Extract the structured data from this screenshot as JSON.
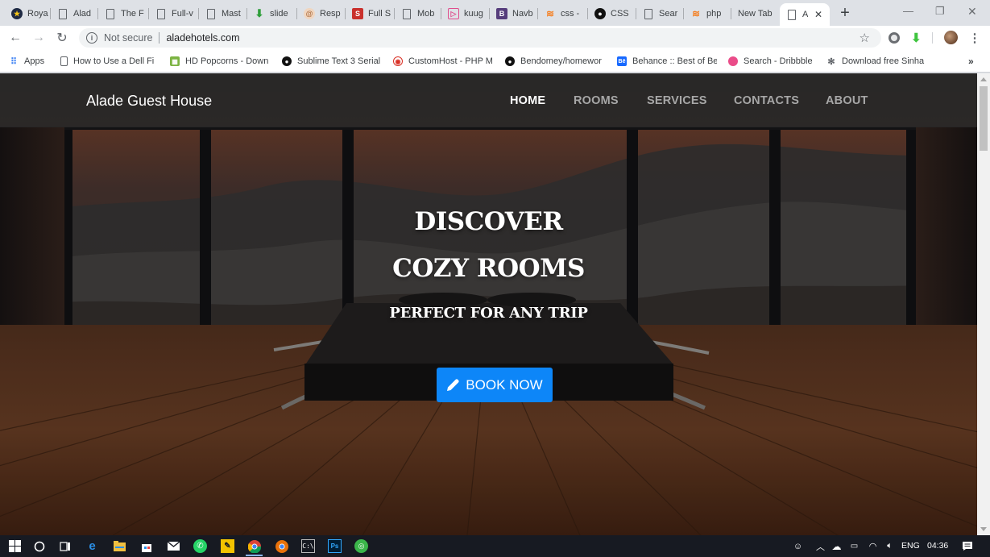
{
  "browser": {
    "tabs": [
      {
        "label": "Roya",
        "icon": "star-badge-icon",
        "color": "#1f2a44"
      },
      {
        "label": "Alad",
        "icon": "page-icon"
      },
      {
        "label": "The F",
        "icon": "page-icon"
      },
      {
        "label": "Full-v",
        "icon": "page-icon"
      },
      {
        "label": "Mast",
        "icon": "page-icon"
      },
      {
        "label": "slide",
        "icon": "download-arrow-icon",
        "color": "#2e9e3a"
      },
      {
        "label": "Resp",
        "icon": "swirl-icon",
        "color": "#d6a27a"
      },
      {
        "label": "Full S",
        "icon": "s-logo-icon",
        "color": "#c9302c"
      },
      {
        "label": "Mob",
        "icon": "page-icon"
      },
      {
        "label": "kuug",
        "icon": "pink-logo-icon",
        "color": "#e04c8c"
      },
      {
        "label": "Navb",
        "icon": "bootstrap-icon",
        "color": "#563d7c"
      },
      {
        "label": "css -",
        "icon": "stackoverflow-icon",
        "color": "#f48024"
      },
      {
        "label": "CSS",
        "icon": "github-icon",
        "color": "#111111"
      },
      {
        "label": "Sear",
        "icon": "page-icon"
      },
      {
        "label": "php",
        "icon": "stackoverflow-icon",
        "color": "#f48024"
      },
      {
        "label": "New Tab",
        "icon": "none"
      },
      {
        "label": "A",
        "icon": "page-icon",
        "active": true
      }
    ],
    "address": {
      "security": "Not secure",
      "url": "aladehotels.com"
    },
    "bookmarks": [
      {
        "label": "Apps",
        "icon": "apps-grid-icon"
      },
      {
        "label": "How to Use a Dell Fi",
        "icon": "page-icon"
      },
      {
        "label": "HD Popcorns - Down",
        "icon": "film-icon",
        "color": "#7cb342"
      },
      {
        "label": "Sublime Text 3 Serial",
        "icon": "github-icon",
        "color": "#111111"
      },
      {
        "label": "CustomHost - PHP M",
        "icon": "host-icon",
        "color": "#d93025"
      },
      {
        "label": "Bendomey/homewor",
        "icon": "github-icon",
        "color": "#111111"
      },
      {
        "label": "Behance :: Best of Bel",
        "icon": "behance-icon",
        "color": "#1769ff"
      },
      {
        "label": "Search - Dribbble",
        "icon": "dribbble-icon",
        "color": "#ea4c89"
      },
      {
        "label": "Download free Sinha",
        "icon": "sparkle-icon",
        "color": "#5f6368"
      }
    ]
  },
  "site": {
    "brand": "Alade Guest House",
    "nav": [
      "HOME",
      "ROOMS",
      "SERVICES",
      "CONTACTS",
      "ABOUT"
    ],
    "active_nav": "HOME",
    "hero": {
      "line1": "DISCOVER",
      "line2": "COZY ROOMS",
      "line3": "PERFECT FOR ANY TRIP",
      "cta": "BOOK NOW"
    },
    "accent": "#0d86f8",
    "navbar_bg": "#282828"
  },
  "taskbar": {
    "language": "ENG",
    "time": "04:36"
  }
}
